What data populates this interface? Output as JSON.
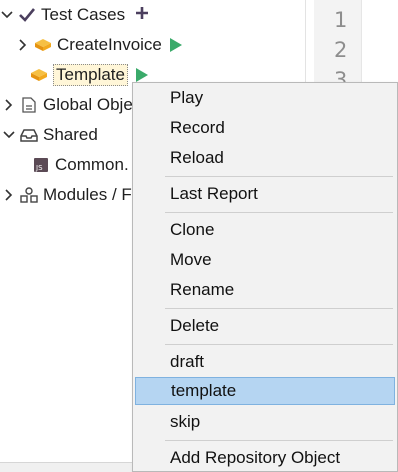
{
  "tree": {
    "test_cases": {
      "label": "Test Cases",
      "add_icon": "plus-icon"
    },
    "create_invoice": {
      "label": "CreateInvoice"
    },
    "template": {
      "label": "Template"
    },
    "global_objects": {
      "label": "Global Obje"
    },
    "shared": {
      "label": "Shared"
    },
    "common": {
      "label": "Common."
    },
    "modules": {
      "label": "Modules / F"
    }
  },
  "editor": {
    "line_numbers": [
      "1",
      "2",
      "3"
    ]
  },
  "context_menu": {
    "items": [
      {
        "label": "Play"
      },
      {
        "label": "Record"
      },
      {
        "label": "Reload"
      },
      {
        "label": "Last Report"
      },
      {
        "label": "Clone"
      },
      {
        "label": "Move"
      },
      {
        "label": "Rename"
      },
      {
        "label": "Delete"
      },
      {
        "label": "draft"
      },
      {
        "label": "template"
      },
      {
        "label": "skip"
      },
      {
        "label": "Add Repository Object"
      }
    ],
    "highlighted_item": "template"
  },
  "colors": {
    "play_green": "#3aaa6a",
    "testcase_orange": "#f2a91d",
    "menu_highlight": "#b5d5f2",
    "check_purple": "#4b3f5e"
  }
}
